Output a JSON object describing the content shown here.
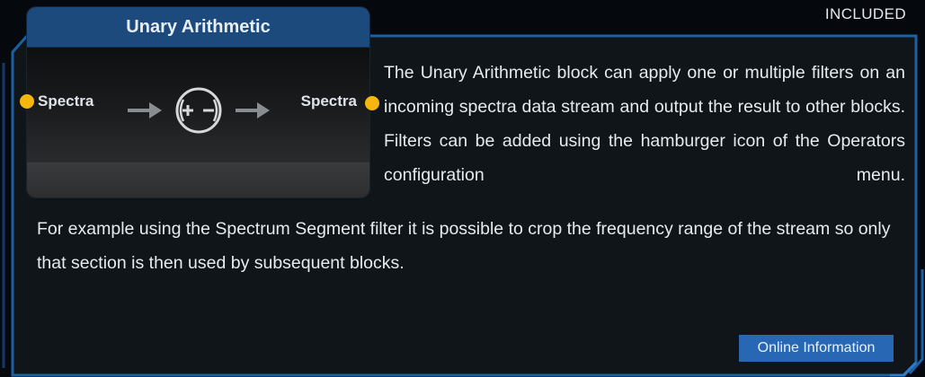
{
  "badge": "INCLUDED",
  "block": {
    "title": "Unary Arithmetic",
    "input_port": "Spectra",
    "output_port": "Spectra",
    "operator_icon": "plus-minus-circle-icon"
  },
  "description": {
    "paragraph1": "The Unary Arithmetic block can apply one or multiple filters on an incoming spectra data stream and output the result to other blocks. Filters can be added using the hamburger icon of the Operators configuration menu.",
    "paragraph2": "For example using the Spectrum Segment filter it is possible to crop the frequency range of the stream so only that section is then used by subsequent blocks."
  },
  "online_button": "Online Information",
  "colors": {
    "background": "#05090d",
    "panel": "#0e1418",
    "frame_accent": "#1e5fa0",
    "header": "#1c4a7c",
    "port": "#f5b60d",
    "button": "#2767b3"
  }
}
